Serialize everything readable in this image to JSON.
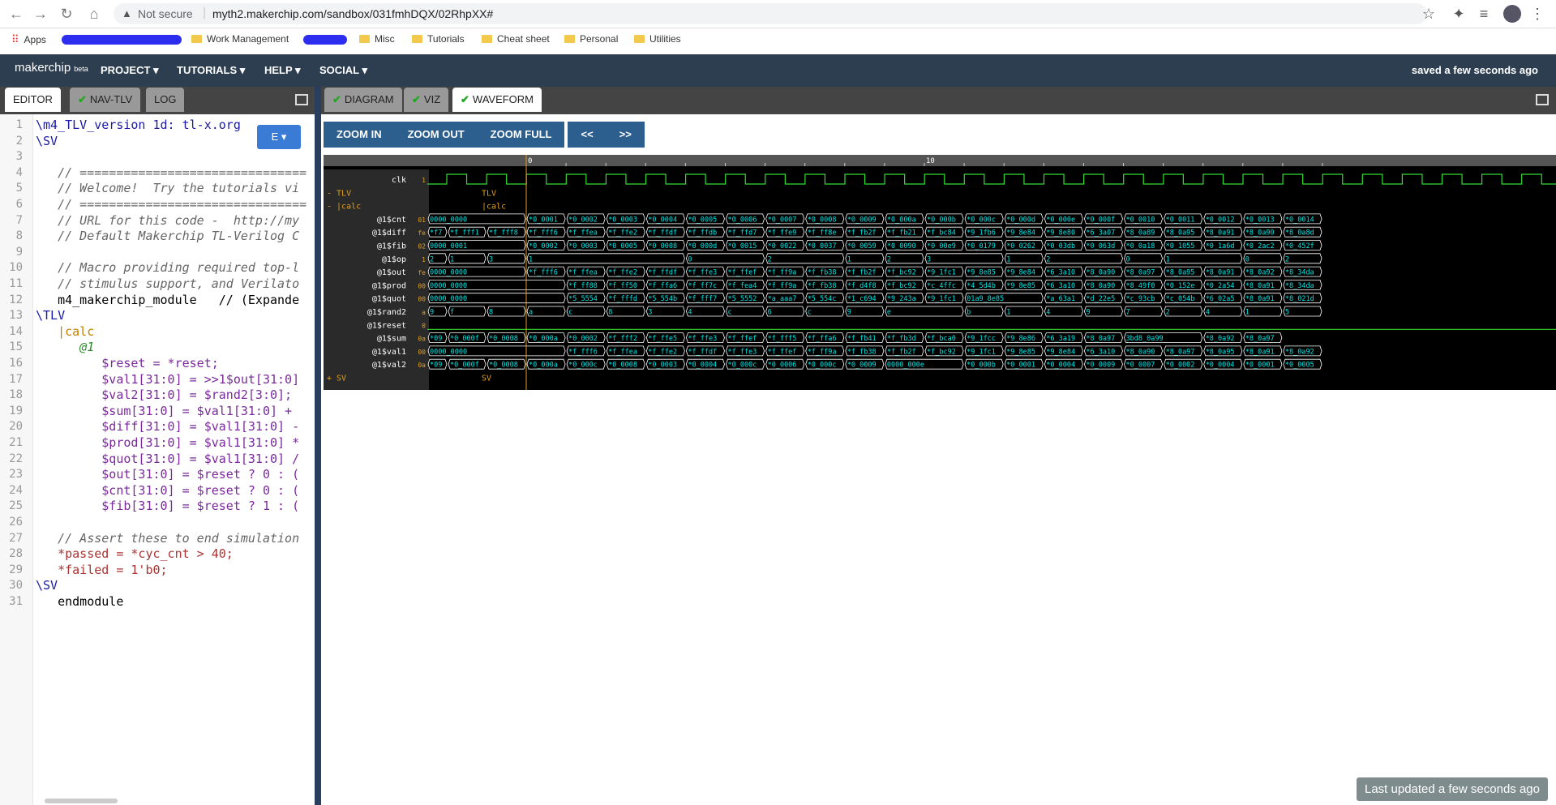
{
  "browser": {
    "not_secure": "Not secure",
    "url": "myth2.makerchip.com/sandbox/031fmhDQX/02RhpXX#",
    "bookmarks": [
      "Apps",
      "Work Management",
      "Misc",
      "Tutorials",
      "Cheat sheet",
      "Personal",
      "Utilities"
    ]
  },
  "app": {
    "logo": "makerchip",
    "logo_suffix": "beta",
    "menus": [
      "PROJECT ▾",
      "TUTORIALS ▾",
      "HELP ▾",
      "SOCIAL ▾"
    ],
    "saved": "saved a few seconds ago"
  },
  "left_tabs": [
    "EDITOR",
    "NAV-TLV",
    "LOG"
  ],
  "right_tabs": [
    "DIAGRAM",
    "VIZ",
    "WAVEFORM"
  ],
  "editor": {
    "e_button": "E ▾",
    "lines": [
      "\\m4_TLV_version 1d: tl-x.org",
      "\\SV",
      "",
      "   // ===============================",
      "   // Welcome!  Try the tutorials vi",
      "   // ===============================",
      "   // URL for this code -  http://my",
      "   // Default Makerchip TL-Verilog C",
      "",
      "   // Macro providing required top-l",
      "   // stimulus support, and Verilato",
      "   m4_makerchip_module   // (Expande",
      "\\TLV",
      "   |calc",
      "      @1",
      "         $reset = *reset;",
      "         $val1[31:0] = >>1$out[31:0]",
      "         $val2[31:0] = $rand2[3:0];",
      "         $sum[31:0] = $val1[31:0] +",
      "         $diff[31:0] = $val1[31:0] -",
      "         $prod[31:0] = $val1[31:0] *",
      "         $quot[31:0] = $val1[31:0] /",
      "         $out[31:0] = $reset ? 0 : (",
      "         $cnt[31:0] = $reset ? 0 : (",
      "         $fib[31:0] = $reset ? 1 : (",
      "",
      "   // Assert these to end simulation",
      "   *passed = *cyc_cnt > 40;",
      "   *failed = 1'b0;",
      "\\SV",
      "   endmodule"
    ]
  },
  "waveform": {
    "zoom": [
      "ZOOM IN",
      "ZOOM OUT",
      "ZOOM FULL"
    ],
    "nav": [
      "<<",
      ">>"
    ],
    "ruler": [
      "0",
      "10"
    ],
    "scope_rows": [
      {
        "label": "- TLV",
        "text": "TLV"
      },
      {
        "label": "-   |calc",
        "text": "|calc"
      }
    ],
    "bottom_row": {
      "label": "+ SV",
      "text": "SV"
    },
    "signals": [
      {
        "name": "clk",
        "type": "clock",
        "cur": "1"
      },
      {
        "name": "@1$cnt",
        "cur": "01",
        "pre": "0000_0000",
        "vals": [
          "*0_0001",
          "*0_0002",
          "*0_0003",
          "*0_0004",
          "*0_0005",
          "*0_0006",
          "*0_0007",
          "*0_0008",
          "*0_0009",
          "*0_000a",
          "*0_000b",
          "*0_000c",
          "*0_000d",
          "*0_000e",
          "*0_000f",
          "*0_0010",
          "*0_0011",
          "*0_0012",
          "*0_0013",
          "*0_0014"
        ]
      },
      {
        "name": "@1$diff",
        "cur": "fe",
        "pre": "*f7|*f_fff1|*f_fff8",
        "vals": [
          "*f_fff6",
          "*f_ffea",
          "*f_ffe2",
          "*f_ffdf",
          "*f_ffdb",
          "*f_ffd7",
          "*f_ffe9",
          "*f_ff8e",
          "*f_fb2f",
          "*f_fb21",
          "*f_bc84",
          "*9_1fb6",
          "*9_8e84",
          "*9_8e80",
          "*6_3a07",
          "*8_0a89",
          "*8_0a95",
          "*8_0a91",
          "*8_0a90",
          "*8_0a8d"
        ]
      },
      {
        "name": "@1$fib",
        "cur": "02",
        "pre": "0000_0001",
        "vals": [
          "*0_0002",
          "*0_0003",
          "*0_0005",
          "*0_0008",
          "*0_000d",
          "*0_0015",
          "*0_0022",
          "*0_0037",
          "*0_0059",
          "*0_0090",
          "*0_00e9",
          "*0_0179",
          "*0_0262",
          "*0_03db",
          "*0_063d",
          "*0_0a18",
          "*0_1055",
          "*0_1a6d",
          "*0_2ac2",
          "*0_452f"
        ]
      },
      {
        "name": "@1$op",
        "cur": "1",
        "pre": "2|1|3",
        "vals": [
          "1",
          "",
          "",
          "",
          "0",
          "",
          "2",
          "",
          "1",
          "2",
          "3",
          "",
          "1",
          "2",
          "",
          "0",
          "1",
          "",
          "0",
          "2"
        ]
      },
      {
        "name": "@1$out",
        "cur": "fe",
        "pre": "0000_0000",
        "vals": [
          "*f_fff6",
          "*f_ffea",
          "*f_ffe2",
          "*f_ffdf",
          "*f_ffe3",
          "*f_ffef",
          "*f_ff9a",
          "*f_fb38",
          "*f_fb2f",
          "*f_bc92",
          "*9_1fc1",
          "*9_8e85",
          "*9_8e84",
          "*6_3a10",
          "*8_0a90",
          "*8_0a97",
          "*8_0a95",
          "*8_0a91",
          "*8_0a92",
          "*8_34da"
        ]
      },
      {
        "name": "@1$prod",
        "cur": "00",
        "pre": "0000_0000",
        "vals": [
          "",
          "*f_ff88",
          "*f_ff50",
          "*f_ffa6",
          "*f_ff7c",
          "*f_fea4",
          "*f_ff9a",
          "*f_fb38",
          "*f_d4f8",
          "*f_bc92",
          "*c_4ffc",
          "*4_5d4b",
          "*9_8e85",
          "*6_3a10",
          "*8_0a90",
          "*8_49f0",
          "*0_152e",
          "*0_2a54",
          "*8_0a91",
          "*8_34da"
        ]
      },
      {
        "name": "@1$quot",
        "cur": "00",
        "pre": "0000_0000",
        "vals": [
          "",
          "*5_5554",
          "*f_fffd",
          "*5_554b",
          "*f_fff7",
          "*5_5552",
          "*a_aaa7",
          "*5_554c",
          "*1_c694",
          "*9_243a",
          "*9_1fc1",
          "01a9_8e85",
          "",
          "*a_63a1",
          "*d_22e5",
          "*c_93cb",
          "*c_054b",
          "*6_02a5",
          "*8_0a91",
          "*8_021d"
        ]
      },
      {
        "name": "@1$rand2",
        "cur": "a",
        "pre": "9|f|8",
        "vals": [
          "a",
          "c",
          "8",
          "3",
          "4",
          "c",
          "6",
          "c",
          "9",
          "e",
          "",
          "b",
          "1",
          "4",
          "9",
          "7",
          "2",
          "4",
          "1",
          "5"
        ]
      },
      {
        "name": "@1$reset",
        "type": "bit",
        "cur": "0"
      },
      {
        "name": "@1$sum",
        "cur": "0a",
        "pre": "*09|*0_000f|*0_0008",
        "vals": [
          "*0_000a",
          "*0_0002",
          "*f_fff2",
          "*f_ffe5",
          "*f_ffe3",
          "*f_ffef",
          "*f_fff5",
          "*f_ffa6",
          "*f_fb41",
          "*f_fb3d",
          "*f_bca0",
          "*9_1fcc",
          "*9_8e86",
          "*6_3a19",
          "*8_0a97",
          "3bd8_0a99",
          "",
          "*8_0a92",
          "*8_0a97"
        ]
      },
      {
        "name": "@1$val1",
        "cur": "00",
        "pre": "0000_0000",
        "vals": [
          "",
          "*f_fff6",
          "*f_ffea",
          "*f_ffe2",
          "*f_ffdf",
          "*f_ffe3",
          "*f_ffef",
          "*f_ff9a",
          "*f_fb38",
          "*f_fb2f",
          "*f_bc92",
          "*9_1fc1",
          "*9_8e85",
          "*9_8e84",
          "*6_3a10",
          "*8_0a90",
          "*8_0a97",
          "*8_0a95",
          "*8_0a91",
          "*8_0a92"
        ]
      },
      {
        "name": "@1$val2",
        "cur": "0a",
        "pre": "*09|*0_000f|*0_0008",
        "vals": [
          "*0_000a",
          "*0_000c",
          "*0_0008",
          "*0_0003",
          "*0_0004",
          "*0_000c",
          "*0_0006",
          "*0_000c",
          "*0_0009",
          "0000_000e",
          "",
          "*0_000b",
          "*0_0001",
          "*0_0004",
          "*0_0009",
          "*0_0007",
          "*0_0002",
          "*0_0004",
          "*0_0001",
          "*0_0005"
        ]
      }
    ],
    "last_updated": "Last updated a few seconds ago"
  },
  "colors": {
    "header_bg": "#2c3e50",
    "wave_text": "#00e5e5",
    "wave_border": "#ffffff",
    "clock_wave": "#33dd33",
    "label_text": "#ffffff",
    "scope_text": "#e0a020",
    "cursor_line": "#e0a020"
  }
}
